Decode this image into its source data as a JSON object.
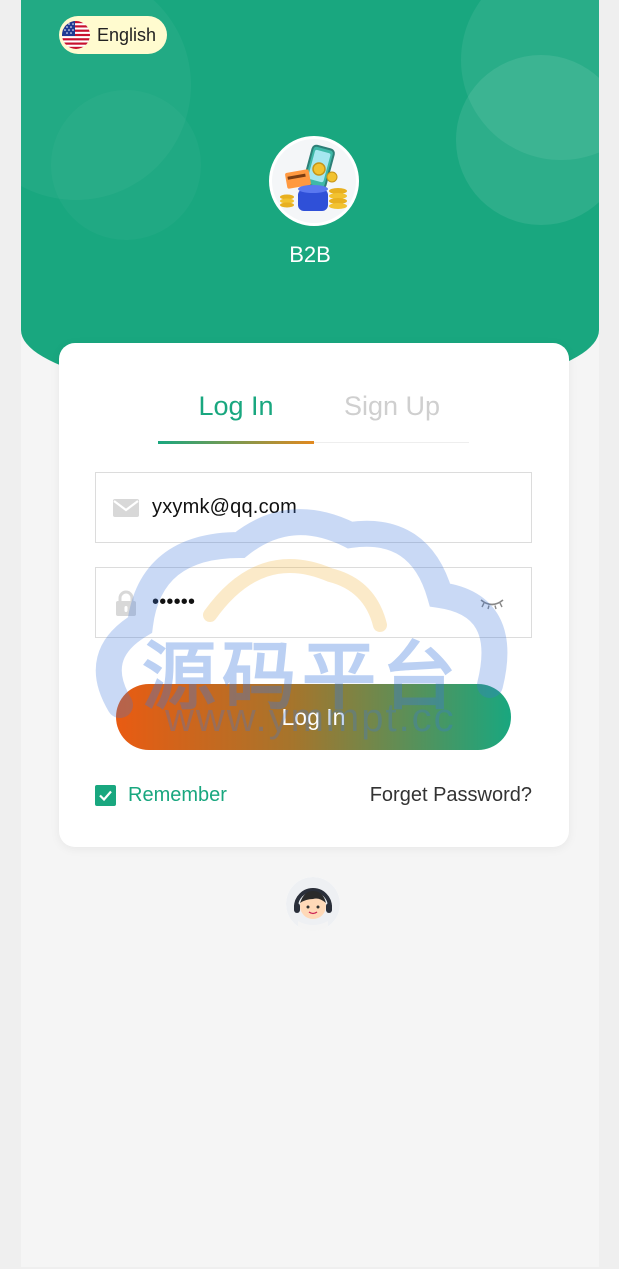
{
  "language": {
    "label": "English",
    "flag_icon": "us-flag-icon"
  },
  "brand": {
    "name": "B2B",
    "logo_icon": "money-phone-logo-icon"
  },
  "tabs": [
    {
      "label": "Log In",
      "active": true
    },
    {
      "label": "Sign Up",
      "active": false
    }
  ],
  "form": {
    "email": {
      "value": "yxymk@qq.com",
      "icon": "mail-icon"
    },
    "password": {
      "value": "••••••",
      "icon": "lock-icon",
      "toggle_icon": "eye-closed-icon"
    },
    "submit_label": "Log In",
    "remember_label": "Remember",
    "remember_checked": true,
    "forget_label": "Forget Password?"
  },
  "support": {
    "icon": "customer-service-avatar-icon"
  },
  "watermark": {
    "title": "源码平台",
    "url": "www.ymmpt.cc"
  },
  "colors": {
    "primary": "#19a77f",
    "accent_orange": "#e95b12",
    "background": "#f5f5f5"
  }
}
